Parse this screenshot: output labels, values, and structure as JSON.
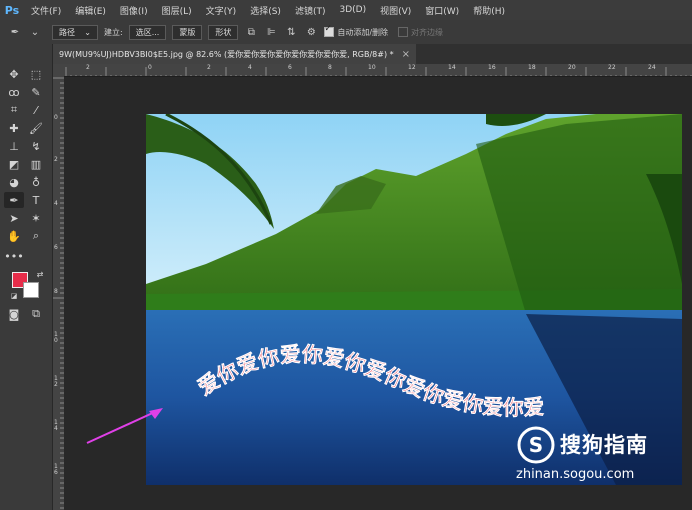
{
  "app": {
    "logo": "Ps"
  },
  "menu": [
    "文件(F)",
    "编辑(E)",
    "图像(I)",
    "图层(L)",
    "文字(Y)",
    "选择(S)",
    "滤镜(T)",
    "3D(D)",
    "视图(V)",
    "窗口(W)",
    "帮助(H)"
  ],
  "options": {
    "mode_value": "路径",
    "make_label": "建立:",
    "selection_btn": "选区...",
    "mask_btn": "蒙版",
    "shape_btn": "形状",
    "auto_add_delete": "自动添加/删除",
    "align_edges": "对齐边缘"
  },
  "document": {
    "tab_title": "9W(MU9%UJ)HDBV3BI0$E5.jpg @ 82.6% (爱你爱你爱你爱你爱你爱你爱你爱, RGB/8#) *",
    "close": "×"
  },
  "rulers": {
    "h_labels": [
      "2",
      "0",
      "2",
      "4",
      "6",
      "8",
      "10",
      "12",
      "14",
      "16",
      "18",
      "20",
      "22",
      "24"
    ],
    "v_labels": [
      "0",
      "2",
      "4",
      "6",
      "8",
      "1\n0",
      "1\n2",
      "1\n4",
      "1\n6"
    ]
  },
  "canvas": {
    "warped_text": "爱你爱你爱你爱你爱你爱你爱你爱你爱",
    "text_color": "#e8283c"
  },
  "watermark": {
    "brand": "搜狗指南",
    "url": "zhinan.sogou.com"
  },
  "colors": {
    "foreground": "#e62d4a",
    "background": "#ffffff",
    "annotation_arrow": "#e040e8"
  }
}
